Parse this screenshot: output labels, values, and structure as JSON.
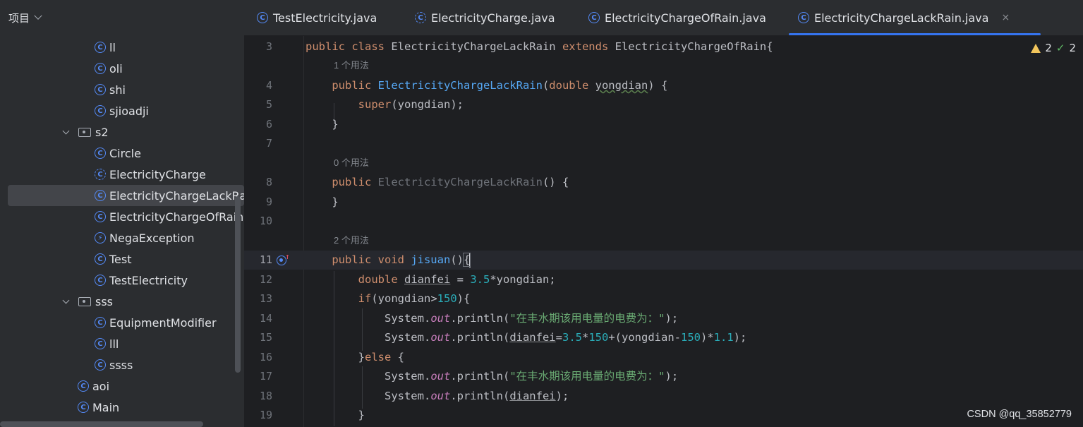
{
  "project": {
    "title": "项目",
    "tree": [
      {
        "label": "ll",
        "kind": "class",
        "level": 2
      },
      {
        "label": "oli",
        "kind": "class",
        "level": 2
      },
      {
        "label": "shi",
        "kind": "class",
        "level": 2
      },
      {
        "label": "sjioadji",
        "kind": "class",
        "level": 2
      },
      {
        "label": "s2",
        "kind": "package",
        "level": 1
      },
      {
        "label": "Circle",
        "kind": "class",
        "level": 2
      },
      {
        "label": "ElectricityCharge",
        "kind": "class-abstract",
        "level": 2
      },
      {
        "label": "ElectricityChargeLackRai",
        "kind": "class",
        "level": 2,
        "selected": true
      },
      {
        "label": "ElectricityChargeOfRain",
        "kind": "class",
        "level": 2
      },
      {
        "label": "NegaException",
        "kind": "exception",
        "level": 2
      },
      {
        "label": "Test",
        "kind": "class",
        "level": 2
      },
      {
        "label": "TestElectricity",
        "kind": "class",
        "level": 2
      },
      {
        "label": "sss",
        "kind": "package",
        "level": 1
      },
      {
        "label": "EquipmentModifier",
        "kind": "class",
        "level": 2
      },
      {
        "label": "lll",
        "kind": "class",
        "level": 2
      },
      {
        "label": "ssss",
        "kind": "class",
        "level": 2
      },
      {
        "label": "aoi",
        "kind": "class",
        "level": 1
      },
      {
        "label": "Main",
        "kind": "class",
        "level": 1
      }
    ]
  },
  "tabs": [
    {
      "label": "TestElectricity.java",
      "active": false
    },
    {
      "label": "ElectricityCharge.java",
      "active": false
    },
    {
      "label": "ElectricityChargeOfRain.java",
      "active": false
    },
    {
      "label": "ElectricityChargeLackRain.java",
      "active": true,
      "close": "×"
    }
  ],
  "inspections": {
    "warnings": "2",
    "ok": "2"
  },
  "editor": {
    "hints": {
      "h1": "1 个用法",
      "h2": "0 个用法",
      "h3": "2 个用法"
    },
    "line_numbers": [
      "3",
      "4",
      "5",
      "6",
      "7",
      "8",
      "9",
      "10",
      "11",
      "12",
      "13",
      "14",
      "15",
      "16",
      "17",
      "18",
      "19"
    ],
    "strings": {
      "msg": "\"在丰水期该用电量的电费为：\""
    }
  },
  "watermark": "CSDN @qq_35852779"
}
